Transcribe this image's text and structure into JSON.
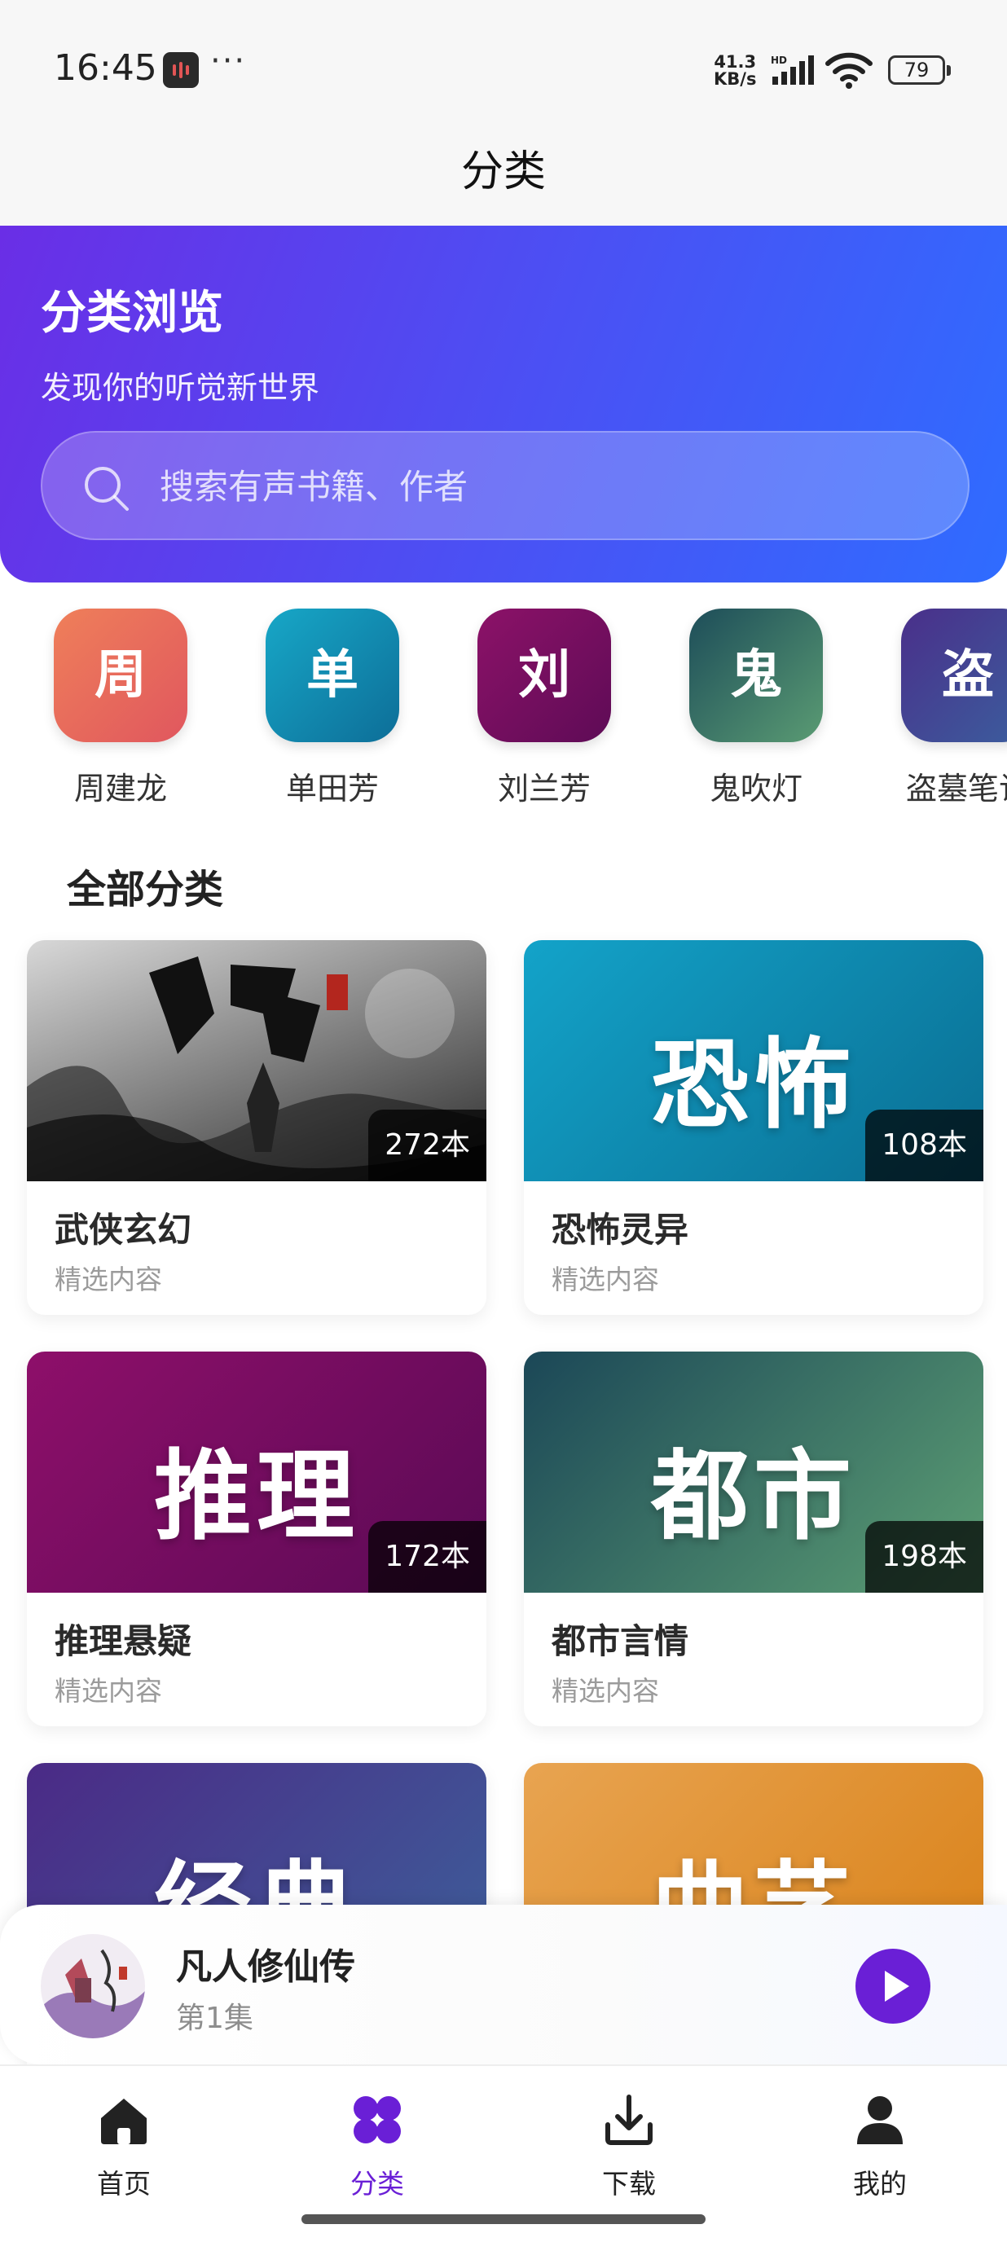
{
  "status_bar": {
    "time": "16:45",
    "more": "···",
    "net_speed_top": "41.3",
    "net_speed_bottom": "KB/s",
    "network": "HD",
    "battery": "79"
  },
  "header": {
    "title": "分类"
  },
  "hero": {
    "title": "分类浏览",
    "subtitle": "发现你的听觉新世界",
    "search_placeholder": "搜索有声书籍、作者"
  },
  "authors": [
    {
      "initial": "周",
      "name": "周建龙",
      "color_from": "#ef7f5a",
      "color_to": "#e0575e"
    },
    {
      "initial": "单",
      "name": "单田芳",
      "color_from": "#17a7c7",
      "color_to": "#0d6e98"
    },
    {
      "initial": "刘",
      "name": "刘兰芳",
      "color_from": "#8c1268",
      "color_to": "#5e0b56"
    },
    {
      "initial": "鬼",
      "name": "鬼吹灯",
      "color_from": "#1d4d59",
      "color_to": "#5a9b73"
    },
    {
      "initial": "盗",
      "name": "盗墓笔记",
      "color_from": "#4a2f8a",
      "color_to": "#3b5e9e"
    }
  ],
  "section": {
    "title": "全部分类"
  },
  "categories": [
    {
      "cover_text": "",
      "count": "272本",
      "name": "武侠玄幻",
      "desc": "精选内容",
      "color_from": "#3b3b3b",
      "color_to": "#cfcfcf"
    },
    {
      "cover_text": "恐怖",
      "count": "108本",
      "name": "恐怖灵异",
      "desc": "精选内容",
      "color_from": "#13a3c9",
      "color_to": "#0a6e93"
    },
    {
      "cover_text": "推理",
      "count": "172本",
      "name": "推理悬疑",
      "desc": "精选内容",
      "color_from": "#8e0f6a",
      "color_to": "#5a0a55"
    },
    {
      "cover_text": "都市",
      "count": "198本",
      "name": "都市言情",
      "desc": "精选内容",
      "color_from": "#1b4757",
      "color_to": "#5d9f74"
    },
    {
      "cover_text": "经典",
      "count": "",
      "name": "",
      "desc": "",
      "color_from": "#4b2a86",
      "color_to": "#3d5f9a"
    },
    {
      "cover_text": "曲艺",
      "count": "",
      "name": "",
      "desc": "",
      "color_from": "#e8a451",
      "color_to": "#d98118"
    }
  ],
  "mini_player": {
    "title": "凡人修仙传",
    "episode": "第1集"
  },
  "bottom_nav": [
    {
      "label": "首页",
      "icon": "home-icon",
      "active": false
    },
    {
      "label": "分类",
      "icon": "category-grid-icon",
      "active": true
    },
    {
      "label": "下载",
      "icon": "download-icon",
      "active": false
    },
    {
      "label": "我的",
      "icon": "profile-icon",
      "active": false
    }
  ],
  "colors": {
    "accent": "#6a1fd6",
    "hero_from": "#6a2ee6",
    "hero_to": "#2f6cff"
  }
}
